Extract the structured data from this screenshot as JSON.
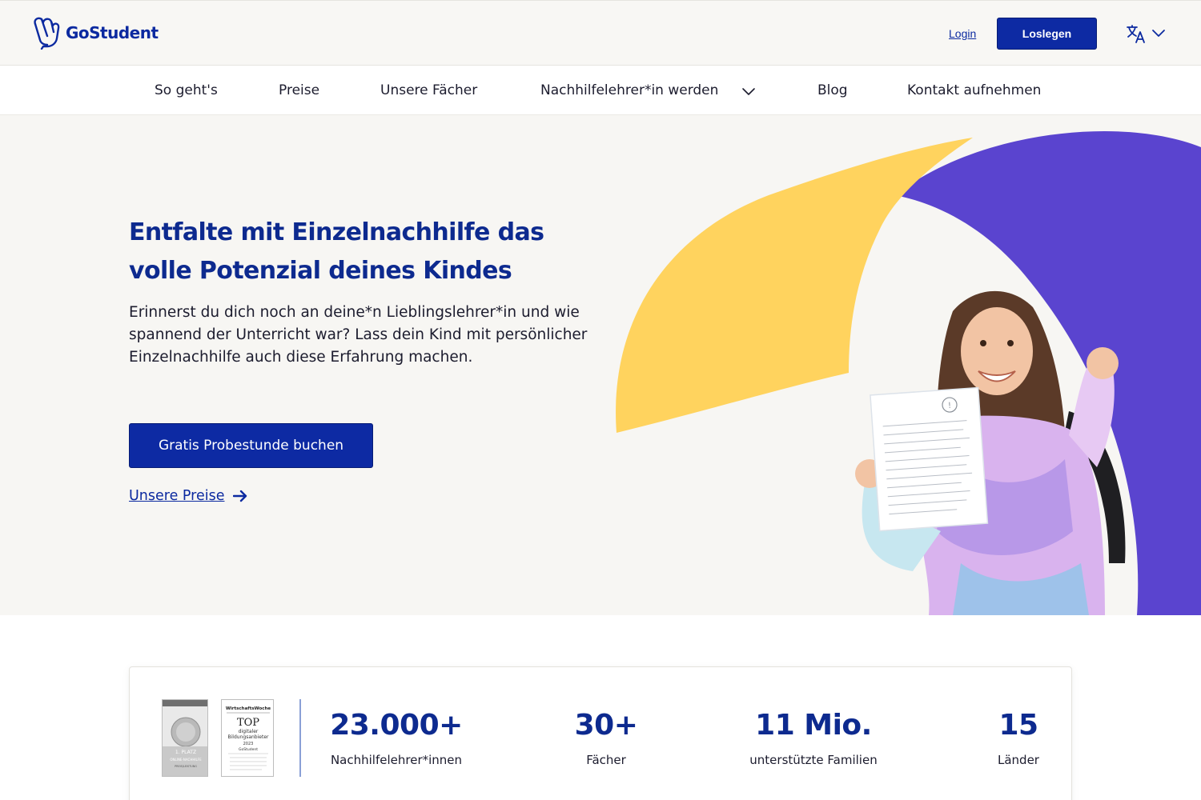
{
  "header": {
    "logo_text": "GoStudent",
    "login_label": "Login",
    "cta_label": "Loslegen",
    "language_icon": "translate-icon"
  },
  "nav": {
    "items": [
      {
        "label": "So geht's"
      },
      {
        "label": "Preise"
      },
      {
        "label": "Unsere Fächer"
      },
      {
        "label": "Nachhilfelehrer*in werden"
      },
      {
        "label": "Blog"
      },
      {
        "label": "Kontakt aufnehmen"
      }
    ]
  },
  "hero": {
    "title": "Entfalte mit Einzelnachhilfe das volle Potenzial deines Kindes",
    "subtitle": "Erinnerst du dich noch an deine*n Lieblingslehrer*in und wie spannend der Unterricht war? Lass dein Kind mit persönlicher Einzelnachhilfe auch diese Erfahrung machen.",
    "cta_label": "Gratis Probestunde buchen",
    "link_label": "Unsere Preise",
    "paper_mark": "!"
  },
  "stats": {
    "badge1": {
      "line1": "1. PLATZ",
      "line2": "ONLINE-NACHHILFE",
      "line3": "PREIS/LEISTUNG"
    },
    "badge2": {
      "publisher": "WirtschaftsWoche",
      "line1": "TOP",
      "line2": "digitaler",
      "line3": "Bildungsanbieter",
      "year": "2023",
      "brand": "GoStudent"
    },
    "items": [
      {
        "value": "23.000+",
        "label": "Nachhilfelehrer*innen"
      },
      {
        "value": "30+",
        "label": "Fächer"
      },
      {
        "value": "11 Mio.",
        "label": "unterstützte Familien"
      },
      {
        "value": "15",
        "label": "Länder"
      }
    ]
  },
  "colors": {
    "brand_blue": "#0d2aa3",
    "title_blue": "#0d2a8f",
    "yellow": "#ffd35e",
    "purple": "#5a44cf",
    "hero_bg": "#f7f6f3"
  }
}
